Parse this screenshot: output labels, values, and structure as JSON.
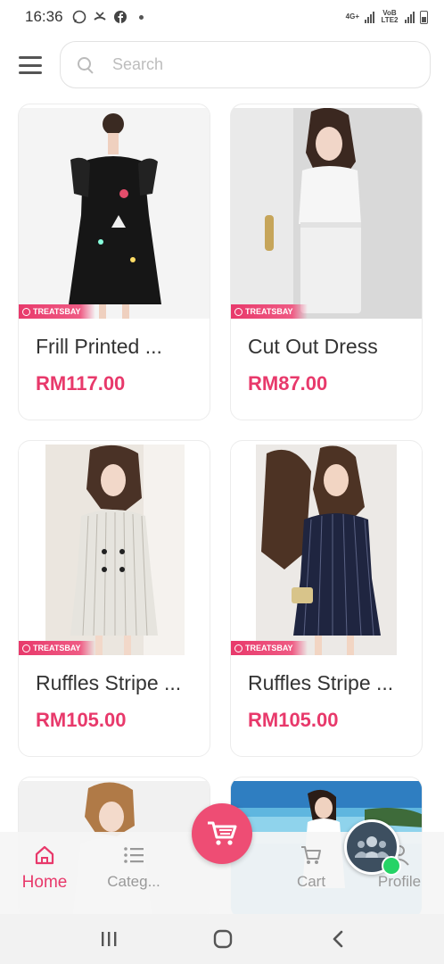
{
  "status_bar": {
    "time": "16:36",
    "network_1": "4G+",
    "network_2": "VoB LTE2",
    "icons": [
      "whatsapp-icon",
      "missed-call-icon",
      "facebook-icon",
      "notification-dot"
    ]
  },
  "search": {
    "placeholder": "Search"
  },
  "products": [
    {
      "name": "Frill Printed ...",
      "price": "RM117.00",
      "badge": "TREATSBAY"
    },
    {
      "name": "Cut Out Dress",
      "price": "RM87.00",
      "badge": "TREATSBAY"
    },
    {
      "name": "Ruffles Stripe ...",
      "price": "RM105.00",
      "badge": "TREATSBAY"
    },
    {
      "name": "Ruffles Stripe ...",
      "price": "RM105.00",
      "badge": "TREATSBAY"
    }
  ],
  "bottom_nav": {
    "home": "Home",
    "categories": "Categ...",
    "cart": "Cart",
    "profile": "Profile"
  },
  "colors": {
    "accent": "#e8396b",
    "fab": "#ee4d74",
    "whatsapp": "#25d366"
  }
}
